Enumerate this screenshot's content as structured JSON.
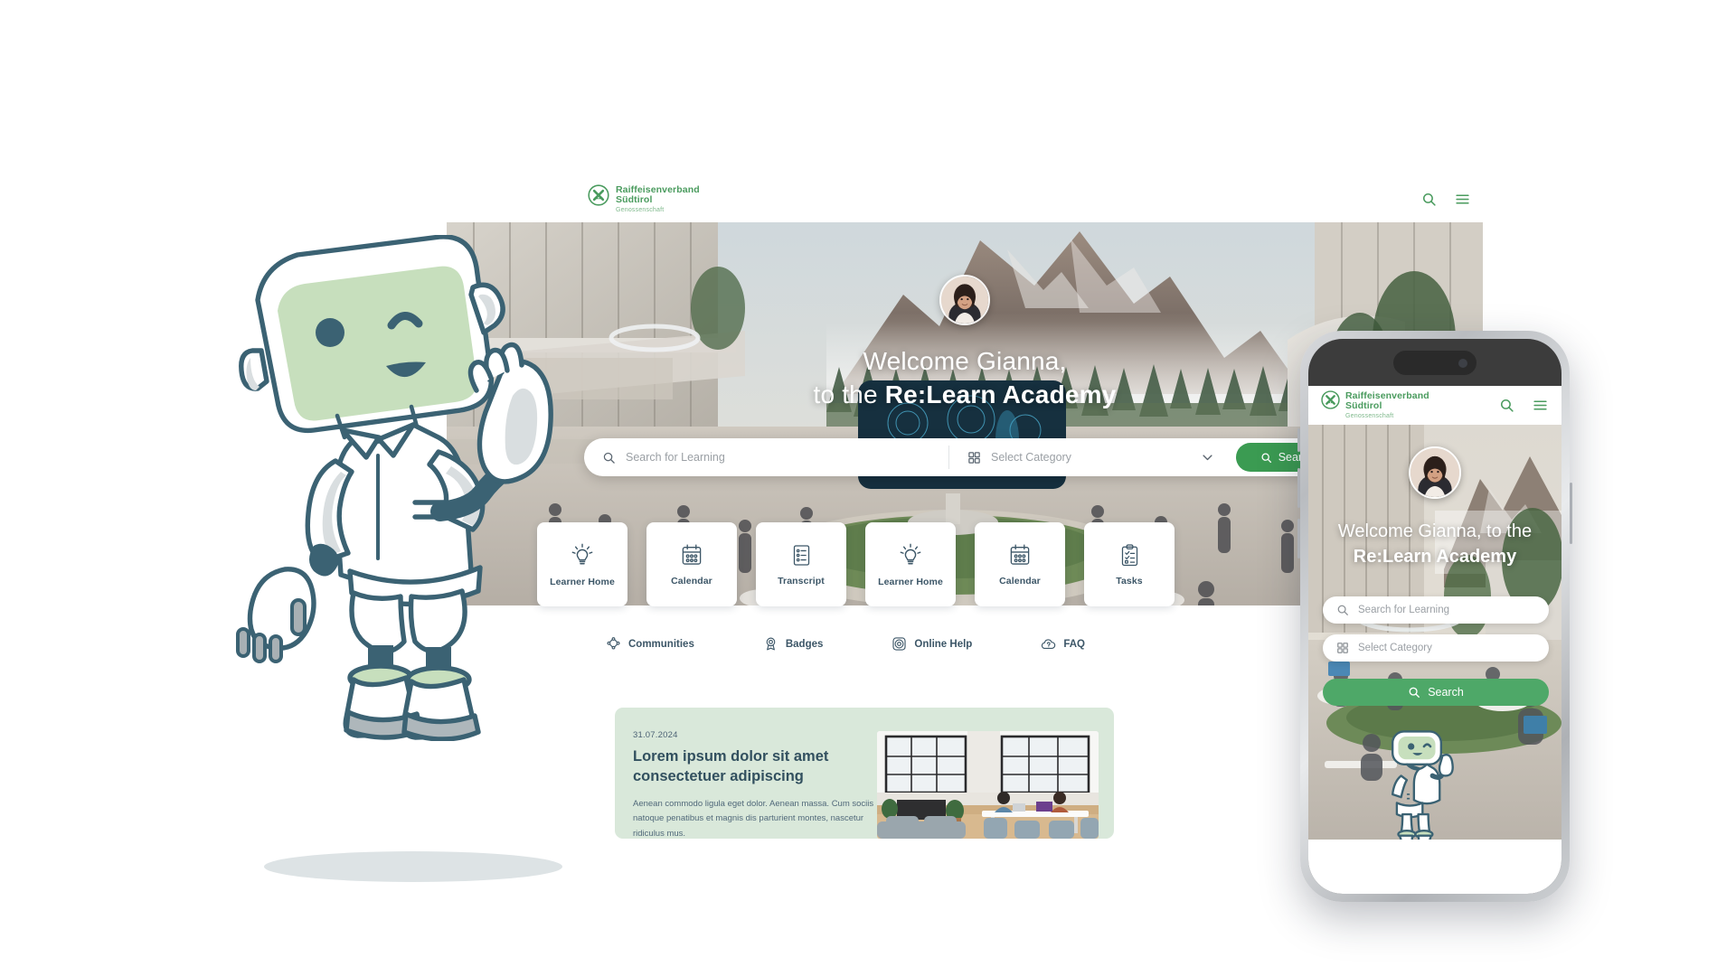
{
  "brand": {
    "logo_line1": "Raiffeisenverband",
    "logo_line2": "Südtirol",
    "logo_line3": "Genossenschaft",
    "green": "#4a9b5e",
    "accent_green": "#3b9b52",
    "dark_slate": "#3c5667"
  },
  "desktop": {
    "nav": {
      "search_icon": "search-icon",
      "menu_icon": "hamburger-menu-icon"
    },
    "hero": {
      "greeting": "Welcome Gianna,",
      "subline_prefix": "to the ",
      "subline_brand": "Re:Learn Academy",
      "avatar_alt": "user-avatar"
    },
    "search": {
      "learning_placeholder": "Search for Learning",
      "category_placeholder": "Select Category",
      "button_label": "Search"
    },
    "tiles": [
      {
        "label": "Learner Home",
        "icon": "lightbulb-icon"
      },
      {
        "label": "Calendar",
        "icon": "calendar-icon"
      },
      {
        "label": "Transcript",
        "icon": "list-document-icon"
      },
      {
        "label": "Learner Home",
        "icon": "lightbulb-icon"
      },
      {
        "label": "Calendar",
        "icon": "calendar-icon"
      },
      {
        "label": "Tasks",
        "icon": "clipboard-check-icon"
      }
    ],
    "quicklinks": [
      {
        "label": "Communities",
        "icon": "communities-icon"
      },
      {
        "label": "Badges",
        "icon": "badge-icon"
      },
      {
        "label": "Online Help",
        "icon": "lifebuoy-icon"
      },
      {
        "label": "FAQ",
        "icon": "faq-cloud-icon"
      }
    ],
    "news": {
      "date": "31.07.2024",
      "title": "Lorem ipsum dolor sit amet consectetuer  adipiscing",
      "body": "Aenean commodo ligula eget dolor. Aenean massa. Cum sociis natoque penatibus et magnis dis parturient montes, nascetur ridiculus mus.",
      "image_alt": "coworking-office-photo"
    }
  },
  "mobile": {
    "hero": {
      "greeting": "Welcome Gianna, to the",
      "brand": "Re:Learn Academy"
    },
    "search": {
      "learning_placeholder": "Search for Learning",
      "category_placeholder": "Select Category",
      "button_label": "Search"
    }
  },
  "mascot": {
    "name": "relearn-robot-mascot",
    "face_color": "#c7dfbd",
    "outline_color": "#3b6273",
    "body_color": "#ffffff"
  }
}
